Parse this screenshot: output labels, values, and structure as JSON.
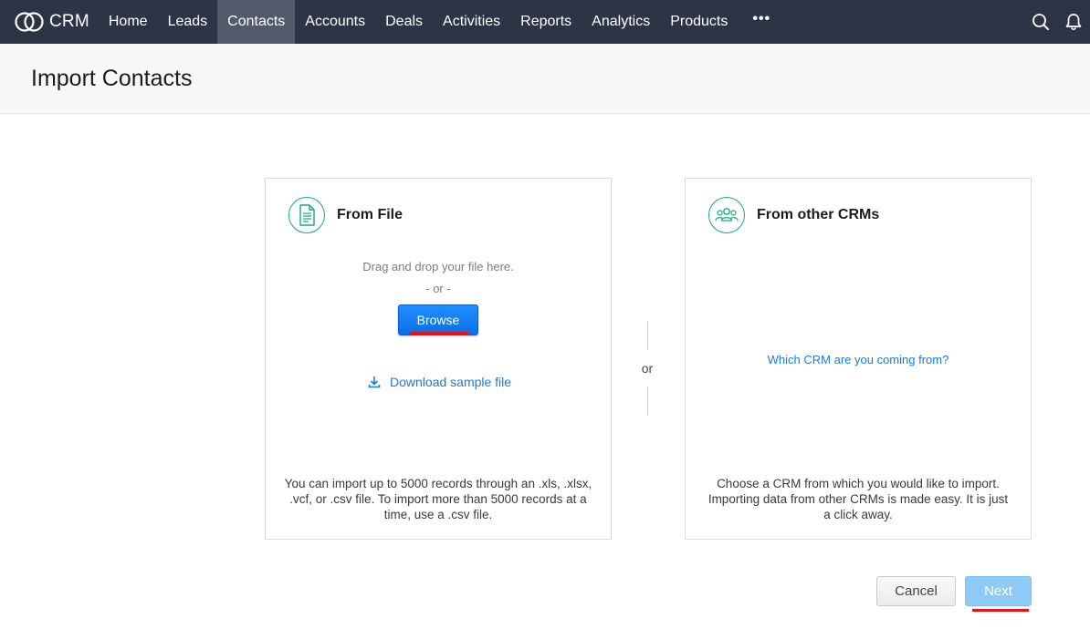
{
  "app": {
    "brand": "CRM"
  },
  "nav": {
    "items": [
      {
        "label": "Home"
      },
      {
        "label": "Leads"
      },
      {
        "label": "Contacts",
        "active": true
      },
      {
        "label": "Accounts"
      },
      {
        "label": "Deals"
      },
      {
        "label": "Activities"
      },
      {
        "label": "Reports"
      },
      {
        "label": "Analytics"
      },
      {
        "label": "Products"
      }
    ],
    "more_label": "•••",
    "icons": [
      "search-icon",
      "bell-icon"
    ]
  },
  "header": {
    "title": "Import Contacts"
  },
  "from_file": {
    "title": "From File",
    "icon": "document-icon",
    "drop_text": "Drag and drop your file here.",
    "or_text": "- or -",
    "browse_label": "Browse",
    "download_label": "Download sample file",
    "footer_text": "You can import up to 5000 records through an .xls, .xlsx, .vcf, or .csv file. To import more than 5000 records at a time, use a .csv file."
  },
  "separator": {
    "label": "or"
  },
  "from_crm": {
    "title": "From other CRMs",
    "icon": "people-icon",
    "link_label": "Which CRM are you coming from?",
    "footer_text": "Choose a CRM from which you would like to import. Importing data from other CRMs is made easy. It is just a click away."
  },
  "actions": {
    "cancel_label": "Cancel",
    "next_label": "Next"
  },
  "colors": {
    "topbar": "#2d3446",
    "active_tab": "#52596a",
    "accent_green": "#1aaa7e",
    "link_blue": "#1f78e6",
    "primary_button": "#0a6fe6",
    "next_disabled": "#8ecbf8",
    "highlight_red": "#e8121a"
  }
}
